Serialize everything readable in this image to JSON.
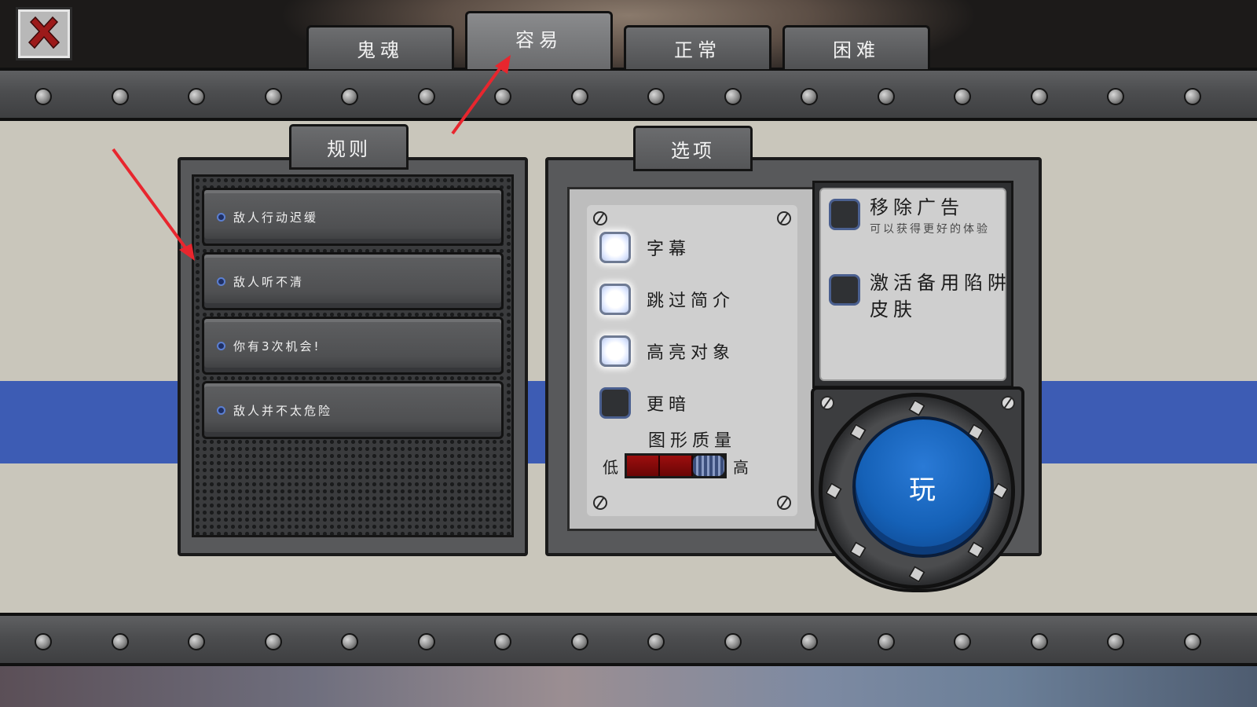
{
  "tabs": [
    {
      "label": "鬼魂",
      "active": false
    },
    {
      "label": "容易",
      "active": true
    },
    {
      "label": "正常",
      "active": false
    },
    {
      "label": "困难",
      "active": false
    }
  ],
  "rules": {
    "header": "规则",
    "items": [
      {
        "label": "敌人行动迟缓"
      },
      {
        "label": "敌人听不清"
      },
      {
        "label": "你有3次机会!"
      },
      {
        "label": "敌人并不太危险"
      }
    ]
  },
  "options": {
    "header": "选项",
    "items": [
      {
        "label": "字幕",
        "checked": true
      },
      {
        "label": "跳过简介",
        "checked": true
      },
      {
        "label": "高亮对象",
        "checked": true
      },
      {
        "label": "更暗",
        "checked": false
      }
    ],
    "graphics_quality": {
      "title": "图形质量",
      "low_label": "低",
      "high_label": "高",
      "level": 0.67
    }
  },
  "extras": {
    "remove_ads": {
      "title": "移除广告",
      "subtitle": "可以获得更好的体验",
      "checked": false
    },
    "alt_trap_skin": {
      "title": "激活备用陷阱皮肤",
      "checked": false
    }
  },
  "play_button": {
    "label": "玩"
  },
  "icons": {
    "close": "close-icon",
    "annotation": "red-arrow-icon"
  },
  "colors": {
    "close_x": "#9c1a1a",
    "stripe": "#3d5cb4",
    "play": "#1561b7",
    "quality_fill": "#9c0e0e",
    "annotation": "#e8262e"
  }
}
